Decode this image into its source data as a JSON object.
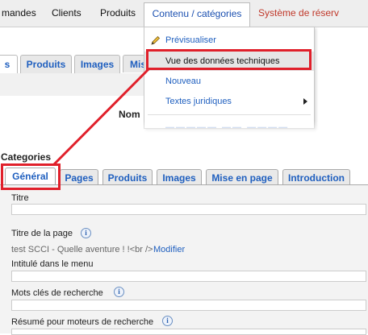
{
  "top_menu": {
    "items": [
      "mandes",
      "Clients",
      "Produits",
      "Contenu / catégories",
      "Système de réserv"
    ]
  },
  "top_tabs": [
    "s",
    "Produits",
    "Images",
    "Mis"
  ],
  "dropdown": {
    "items": [
      {
        "label": "Prévisualiser",
        "icon": "pencil-icon"
      },
      {
        "label": "Vue des données techniques"
      },
      {
        "label": "Nouveau"
      },
      {
        "label": "Textes juridiques",
        "submenu": true
      }
    ]
  },
  "top_panel": {
    "column_label": "Nom"
  },
  "categories": {
    "title": "Categories",
    "tabs": [
      "Général",
      "Pages",
      "Produits",
      "Images",
      "Mise en page",
      "Introduction"
    ],
    "form": {
      "titre_label": "Titre",
      "page_title_label": "Titre de la page",
      "page_title_value": "test SCCI - Quelle aventure ! !<br />",
      "modify_link": "Modifier",
      "menu_label": "Intitulé dans le menu",
      "keywords_label": "Mots clés de recherche",
      "summary_label": "Résumé pour moteurs de recherche"
    }
  },
  "colors": {
    "annotation_red": "#e0202b",
    "link_blue": "#1f5fbf"
  }
}
